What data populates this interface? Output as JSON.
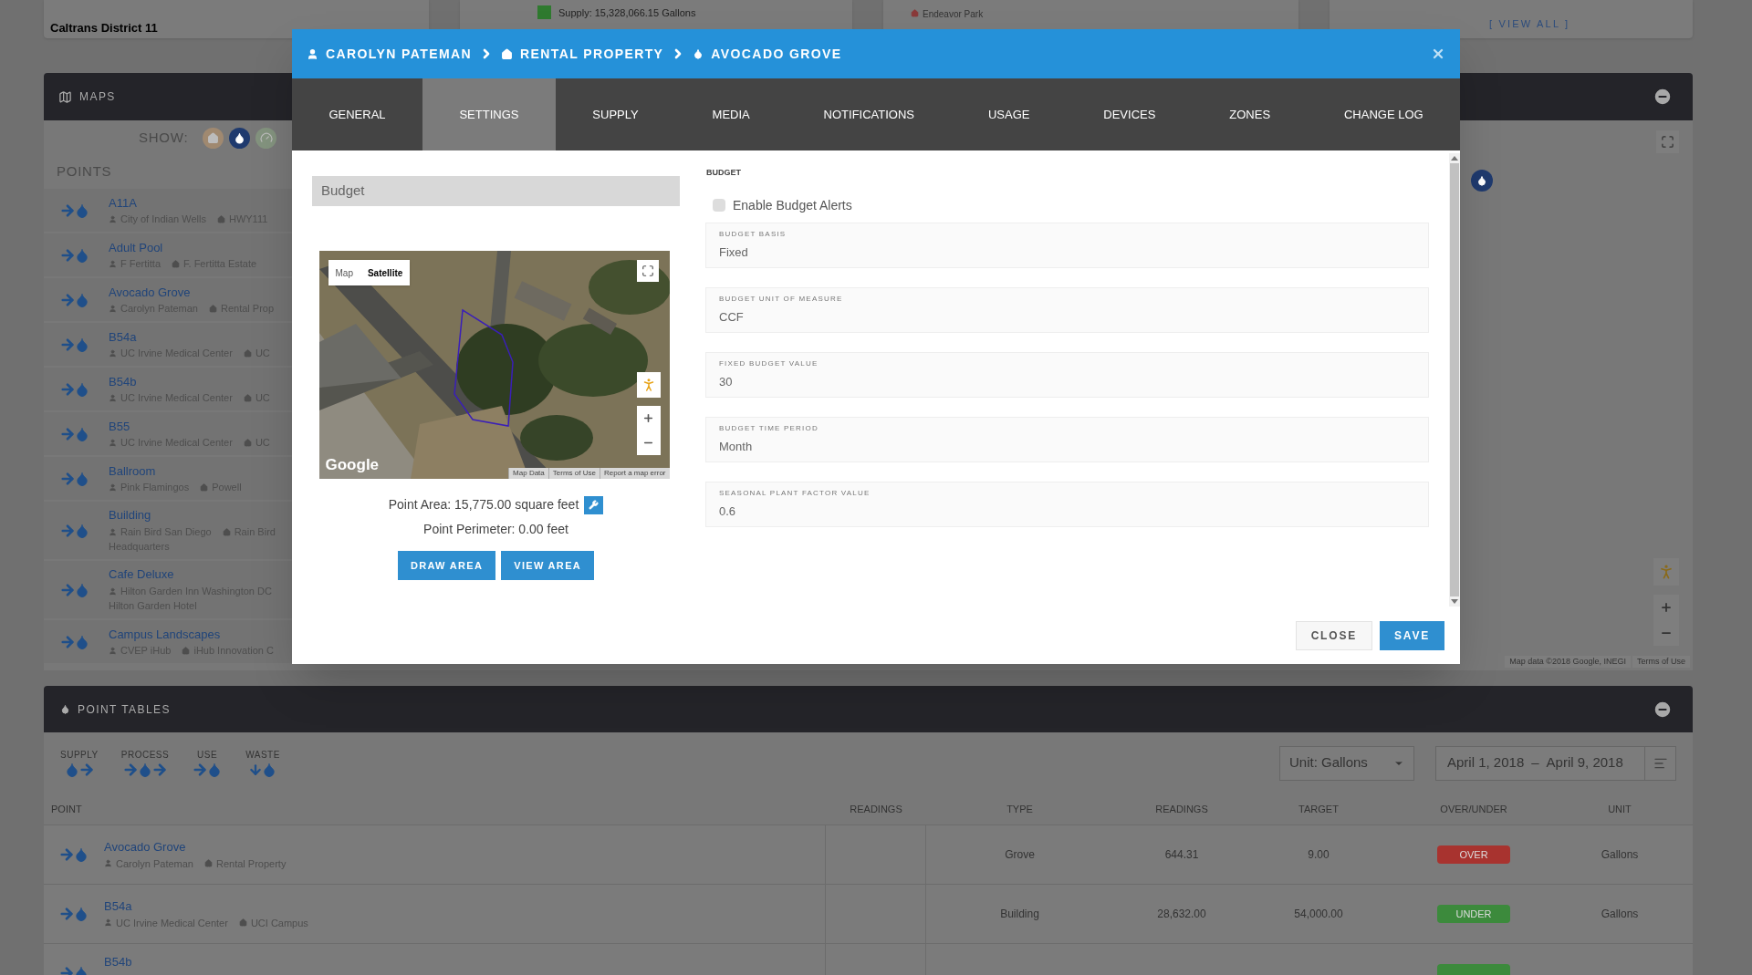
{
  "summary_cards": {
    "district": "Caltrans District 11",
    "supply": "Supply: 15,328,066.15 Gallons",
    "park": "Endeavor Park",
    "view_all": "[ VIEW ALL ]"
  },
  "maps": {
    "title": "MAPS",
    "show_label": "SHOW:",
    "show": [
      {
        "kind": "home",
        "selected": false
      },
      {
        "kind": "drop",
        "selected": true
      },
      {
        "kind": "gauge",
        "selected": false
      }
    ],
    "points_label": "POINTS",
    "points": [
      {
        "name": "A11A",
        "owner": "City of Indian Wells",
        "property": "HWY111"
      },
      {
        "name": "Adult Pool",
        "owner": "F Fertitta",
        "property": "F. Fertitta Estate"
      },
      {
        "name": "Avocado Grove",
        "owner": "Carolyn Pateman",
        "property": "Rental Prop"
      },
      {
        "name": "B54a",
        "owner": "UC Irvine Medical Center",
        "property": "UC"
      },
      {
        "name": "B54b",
        "owner": "UC Irvine Medical Center",
        "property": "UC"
      },
      {
        "name": "B55",
        "owner": "UC Irvine Medical Center",
        "property": "UC"
      },
      {
        "name": "Ballroom",
        "owner": "Pink Flamingos",
        "property": "Powell"
      },
      {
        "name": "Building",
        "owner": "Rain Bird San Diego",
        "property": "Rain Bird",
        "extra": "Headquarters"
      },
      {
        "name": "Cafe Deluxe",
        "owner": "Hilton Garden Inn Washington DC",
        "extra": "Hilton Garden Hotel"
      },
      {
        "name": "Campus Landscapes",
        "owner": "CVEP iHub",
        "property": "iHub Innovation C"
      }
    ],
    "attribution": [
      "Map data ©2018 Google, INEGI",
      "Terms of Use"
    ]
  },
  "modal": {
    "breadcrumb": [
      {
        "kind": "user",
        "label": "CAROLYN PATEMAN"
      },
      {
        "kind": "home",
        "label": "RENTAL PROPERTY"
      },
      {
        "kind": "drop",
        "label": "AVOCADO GROVE"
      }
    ],
    "tabs": [
      {
        "label": "GENERAL",
        "selected": false
      },
      {
        "label": "SETTINGS",
        "selected": true
      },
      {
        "label": "SUPPLY",
        "selected": false
      },
      {
        "label": "MEDIA",
        "selected": false
      },
      {
        "label": "NOTIFICATIONS",
        "selected": false
      },
      {
        "label": "USAGE",
        "selected": false
      },
      {
        "label": "DEVICES",
        "selected": false
      },
      {
        "label": "ZONES",
        "selected": false
      },
      {
        "label": "CHANGE LOG",
        "selected": false
      }
    ],
    "category": {
      "value": "Budget"
    },
    "map": {
      "types": [
        {
          "label": "Map",
          "selected": false
        },
        {
          "label": "Satellite",
          "selected": true
        }
      ],
      "logo": "Google",
      "links": [
        "Map Data",
        "Terms of Use",
        "Report a map error"
      ]
    },
    "area": "Point Area: 15,775.00 square feet",
    "perimeter": "Point Perimeter: 0.00 feet",
    "area_buttons": [
      "DRAW AREA",
      "VIEW AREA"
    ],
    "section": "BUDGET",
    "alerts": {
      "label": "Enable Budget Alerts",
      "checked": false
    },
    "fields": [
      {
        "label": "BUDGET BASIS",
        "value": "Fixed"
      },
      {
        "label": "BUDGET UNIT OF MEASURE",
        "value": "CCF"
      },
      {
        "label": "FIXED BUDGET VALUE",
        "value": "30"
      },
      {
        "label": "BUDGET TIME PERIOD",
        "value": "Month"
      },
      {
        "label": "SEASONAL PLANT FACTOR VALUE",
        "value": "0.6"
      }
    ],
    "buttons": [
      {
        "kind": "secondary",
        "label": "CLOSE"
      },
      {
        "kind": "primary",
        "label": "SAVE"
      }
    ]
  },
  "point_tables": {
    "title": "POINT TABLES",
    "legend": [
      {
        "kind": "supply",
        "label": "SUPPLY"
      },
      {
        "kind": "process",
        "label": "PROCESS"
      },
      {
        "kind": "use",
        "label": "USE"
      },
      {
        "kind": "waste",
        "label": "WASTE"
      }
    ],
    "unit": "Unit: Gallons",
    "date_from": "April 1, 2018",
    "date_sep": "–",
    "date_to": "April 9, 2018",
    "columns": [
      "POINT",
      "READINGS",
      "TYPE",
      "READINGS",
      "TARGET",
      "OVER/UNDER",
      "UNIT"
    ],
    "rows": [
      {
        "name": "Avocado Grove",
        "owner": "Carolyn Pateman",
        "property": "Rental Property",
        "type": "Grove",
        "readings": "644.31",
        "target": "9.00",
        "status": "OVER",
        "color": "#a8332f",
        "unit": "Gallons"
      },
      {
        "name": "B54a",
        "owner": "UC Irvine Medical Center",
        "property": "UCI Campus",
        "type": "Building",
        "readings": "28,632.00",
        "target": "54,000.00",
        "status": "UNDER",
        "color": "#3c8a3c",
        "unit": "Gallons"
      },
      {
        "name": "B54b",
        "color": "#3c8a3c"
      }
    ]
  }
}
